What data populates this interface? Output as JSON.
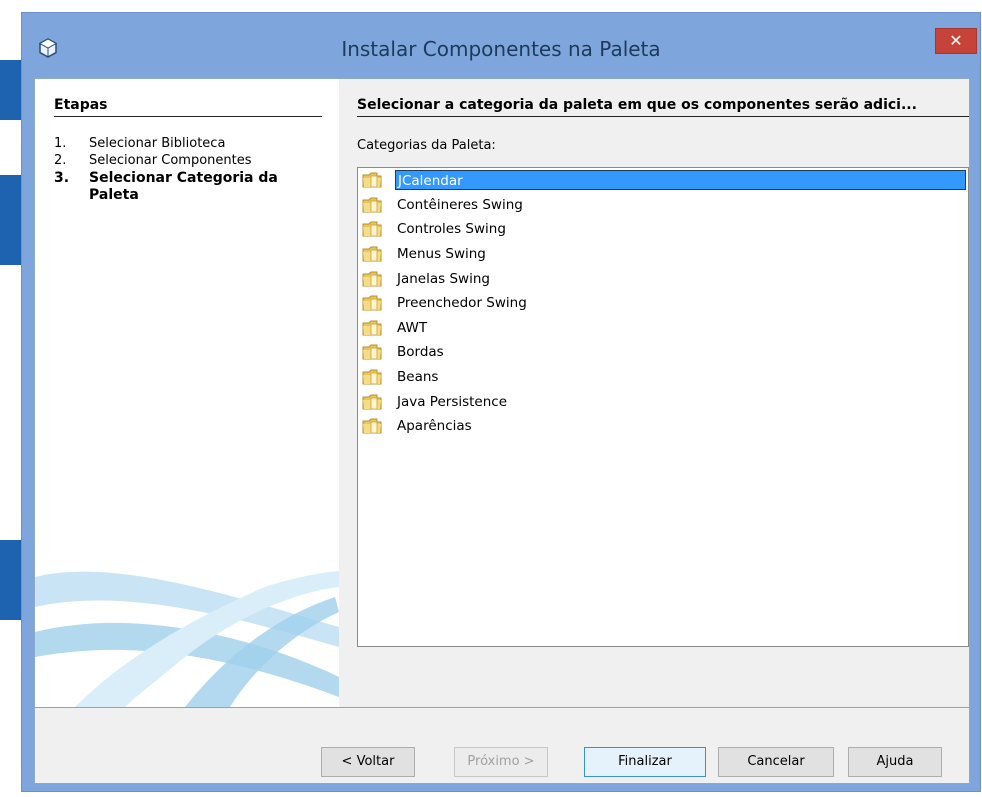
{
  "window": {
    "title": "Instalar Componentes na Paleta",
    "close_label": "✕"
  },
  "steps": {
    "title": "Etapas",
    "items": [
      {
        "num": "1.",
        "label": "Selecionar Biblioteca"
      },
      {
        "num": "2.",
        "label": "Selecionar Componentes"
      },
      {
        "num": "3.",
        "label": "Selecionar Categoria da Paleta",
        "current": true
      }
    ]
  },
  "main": {
    "heading": "Selecionar a categoria da paleta em que os componentes serão adici...",
    "list_label": "Categorias da Paleta:",
    "categories": [
      {
        "label": "JCalendar",
        "selected": true
      },
      {
        "label": "Contêineres Swing"
      },
      {
        "label": "Controles Swing"
      },
      {
        "label": "Menus Swing"
      },
      {
        "label": "Janelas Swing"
      },
      {
        "label": "Preenchedor Swing"
      },
      {
        "label": "AWT"
      },
      {
        "label": "Bordas"
      },
      {
        "label": "Beans"
      },
      {
        "label": "Java Persistence"
      },
      {
        "label": "Aparências"
      }
    ],
    "folder_icon": "folder-icon"
  },
  "buttons": {
    "back": "< Voltar",
    "next": "Próximo >",
    "finish": "Finalizar",
    "cancel": "Cancelar",
    "help": "Ajuda"
  },
  "colors": {
    "titlebar": "#7ea6dc",
    "selection": "#3399ff",
    "close": "#c7433a"
  }
}
